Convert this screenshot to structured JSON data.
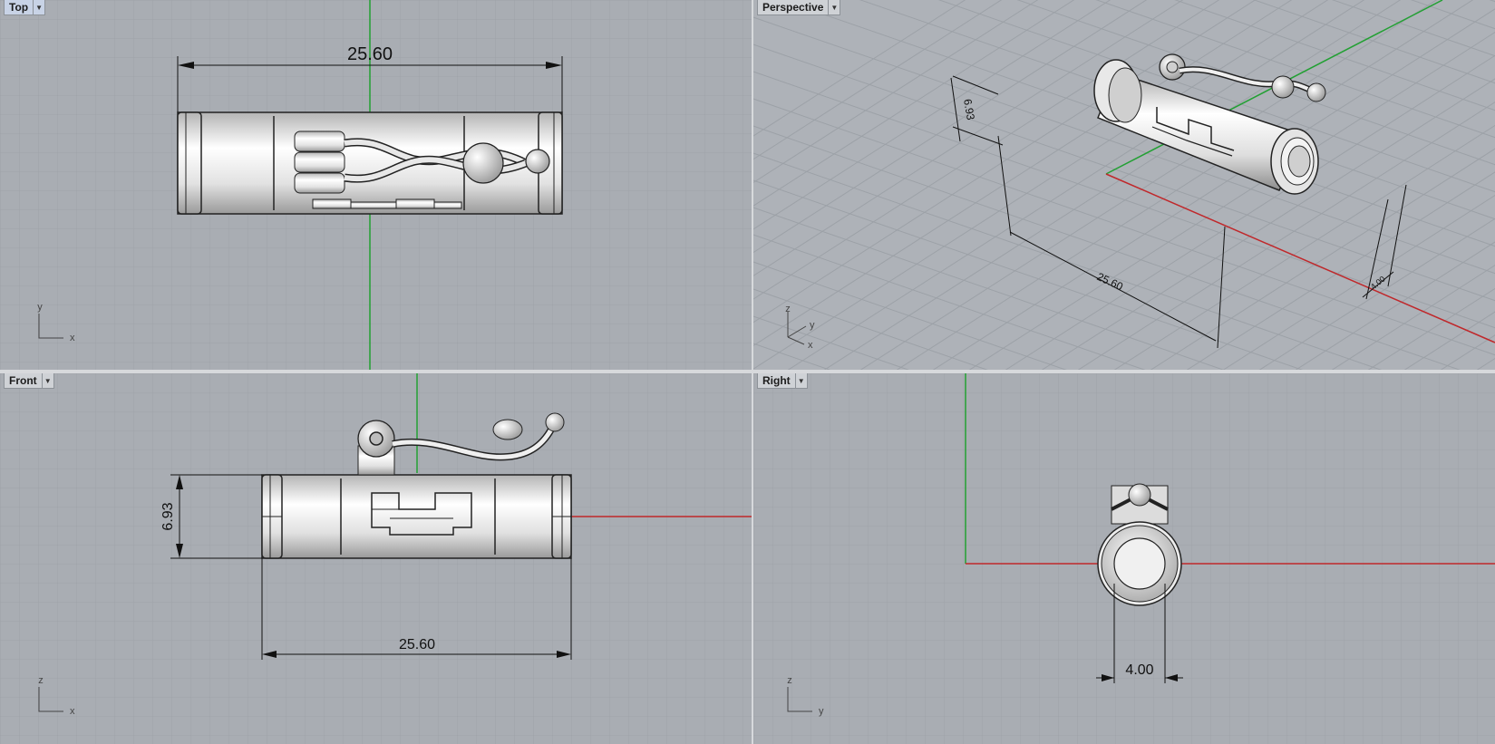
{
  "viewports": {
    "top": {
      "label": "Top",
      "dims": {
        "length": "25.60"
      },
      "axes": {
        "a": "y",
        "b": "x"
      }
    },
    "perspective": {
      "label": "Perspective",
      "dims": {
        "height": "6.93",
        "length": "25.60",
        "small": "4.00"
      },
      "axes": {
        "a": "z",
        "b": "y",
        "c": "x"
      }
    },
    "front": {
      "label": "Front",
      "dims": {
        "height": "6.93",
        "length": "25.60"
      },
      "axes": {
        "a": "z",
        "b": "x"
      }
    },
    "right": {
      "label": "Right",
      "dims": {
        "width": "4.00"
      },
      "axes": {
        "a": "z",
        "b": "y"
      }
    }
  },
  "dropdown_glyph": "▼",
  "colors": {
    "viewport_bg": "#a9adb3",
    "grid_minor": "#9ea2a8",
    "grid_major": "#8f949a",
    "x_axis": "#c0282b",
    "y_axis": "#22a033",
    "frame": "#d7d9dc"
  }
}
